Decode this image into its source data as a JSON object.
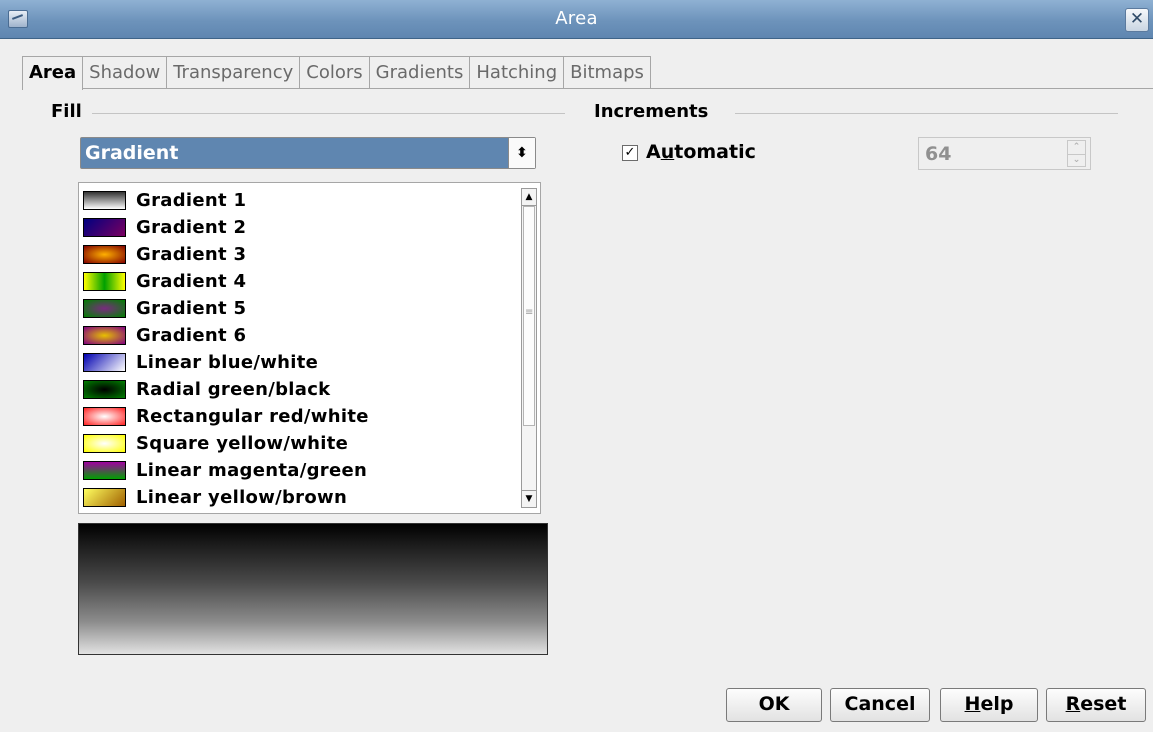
{
  "window": {
    "title": "Area"
  },
  "tabs": [
    {
      "label": "Area",
      "active": true
    },
    {
      "label": "Shadow",
      "active": false
    },
    {
      "label": "Transparency",
      "active": false
    },
    {
      "label": "Colors",
      "active": false
    },
    {
      "label": "Gradients",
      "active": false
    },
    {
      "label": "Hatching",
      "active": false
    },
    {
      "label": "Bitmaps",
      "active": false
    }
  ],
  "fill": {
    "label": "Fill",
    "type_value": "Gradient",
    "items": [
      {
        "label": "Gradient 1",
        "swatch": "linear-gradient(#333,#fff)"
      },
      {
        "label": "Gradient 2",
        "swatch": "linear-gradient(135deg,#000080,#7a0060)"
      },
      {
        "label": "Gradient 3",
        "swatch": "radial-gradient(#ffb000,#800000)"
      },
      {
        "label": "Gradient 4",
        "swatch": "linear-gradient(90deg,#ffff00,#00a000,#ffff00)"
      },
      {
        "label": "Gradient 5",
        "swatch": "radial-gradient(#7a2a80,#008000)"
      },
      {
        "label": "Gradient 6",
        "swatch": "radial-gradient(#e8c000,#800080)"
      },
      {
        "label": "Linear blue/white",
        "swatch": "linear-gradient(135deg,#0000b0,#fff)"
      },
      {
        "label": "Radial green/black",
        "swatch": "radial-gradient(#000,#008000)"
      },
      {
        "label": "Rectangular red/white",
        "swatch": "radial-gradient(#fff,#ff2020)"
      },
      {
        "label": "Square yellow/white",
        "swatch": "radial-gradient(#fff,#ffff00)"
      },
      {
        "label": "Linear magenta/green",
        "swatch": "linear-gradient(#a000a0,#00a000)"
      },
      {
        "label": "Linear yellow/brown",
        "swatch": "linear-gradient(135deg,#ffff60,#a06000)"
      }
    ]
  },
  "increments": {
    "label": "Increments",
    "automatic_label_pre": "A",
    "automatic_label_mnemonic": "u",
    "automatic_label_post": "tomatic",
    "automatic_checked": "✓",
    "steps_value": "64"
  },
  "buttons": {
    "ok": "OK",
    "cancel": "Cancel",
    "help_mnemonic": "H",
    "help_rest": "elp",
    "reset_mnemonic": "R",
    "reset_rest": "eset"
  },
  "icons": {
    "app": "window-menu-icon",
    "close": "close-icon"
  }
}
